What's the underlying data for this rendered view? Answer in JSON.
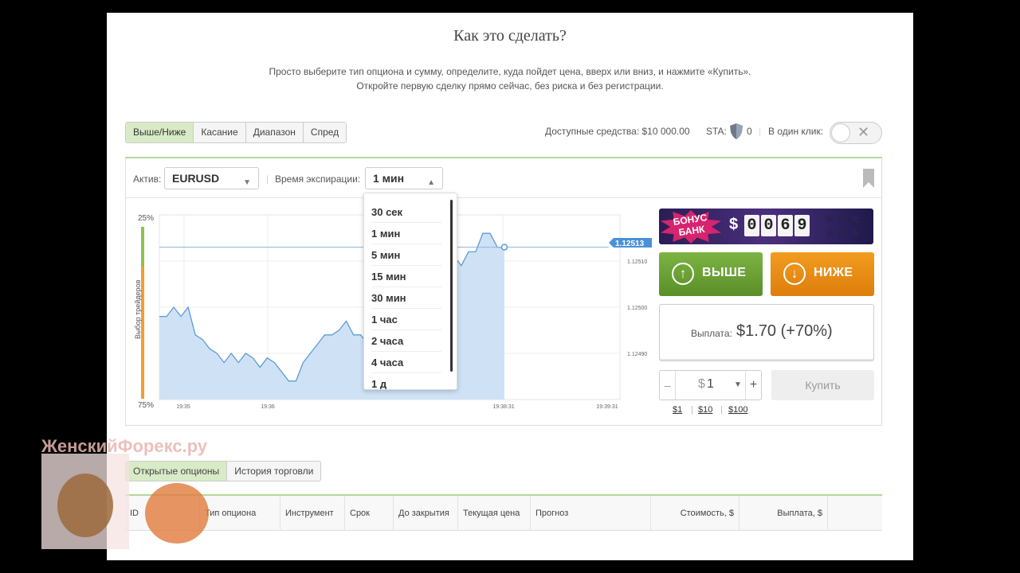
{
  "heading": "Как это сделать?",
  "intro_line1": "Просто выберите тип опциона и сумму, определите, куда пойдет цена, вверх или вниз, и нажмите «Купить».",
  "intro_line2": "Откройте первую сделку прямо сейчас, без риска и без регистрации.",
  "option_tabs": [
    "Выше/Ниже",
    "Касание",
    "Диапазон",
    "Спред"
  ],
  "active_tab": "Выше/Ниже",
  "balance_label": "Доступные средства: $10 000.00",
  "sta_label": "STA:",
  "sta_value": "0",
  "one_click_label": "В один клик:",
  "asset_label": "Актив:",
  "asset_value": "EURUSD",
  "expiry_label": "Время экспирации:",
  "expiry_value": "1 мин",
  "expiry_options": [
    "30 сек",
    "1 мин",
    "5 мин",
    "15 мин",
    "30 мин",
    "1 час",
    "2 часа",
    "4 часа",
    "1 д"
  ],
  "chart": {
    "traders_label": "Выбор трейдеров",
    "pct_top": "25%",
    "pct_bottom": "75%",
    "current_price": "1.12513",
    "y_ticks": [
      "1.12510",
      "1.12500",
      "1.12490"
    ],
    "x_ticks": [
      "19:35",
      "19:36",
      "19:38:31",
      "19:39:31"
    ],
    "colors": {
      "line": "#5b9bd5",
      "fill": "#cfe2f5",
      "up_bar": "#8bc34a",
      "down_bar": "#f0a030"
    }
  },
  "chart_data": {
    "type": "area",
    "series": [
      {
        "values": [
          1.12498,
          1.12498,
          1.125,
          1.12498,
          1.125,
          1.12494,
          1.12493,
          1.12491,
          1.1249,
          1.12488,
          1.1249,
          1.12488,
          1.1249,
          1.12489,
          1.12487,
          1.12489,
          1.12488,
          1.12486,
          1.12484,
          1.12484,
          1.12488,
          1.1249,
          1.12492,
          1.12494,
          1.12494,
          1.12495,
          1.12497,
          1.12494,
          1.12494,
          1.12492,
          1.12492,
          1.12492,
          1.12492,
          1.12492,
          1.12492,
          1.12493,
          1.12493,
          1.12493,
          1.12493,
          1.12493,
          1.1251,
          1.12511,
          1.12509,
          1.12512,
          1.12512,
          1.12516,
          1.12516,
          1.12513,
          1.12513
        ]
      }
    ],
    "ylim": [
      1.1248,
      1.1252
    ]
  },
  "bonus": {
    "badge": "БОНУС БАНК",
    "currency": "$",
    "digits": [
      "0",
      "0",
      "6",
      "9"
    ]
  },
  "up_label": "ВЫШЕ",
  "down_label": "НИЖЕ",
  "payout_label": "Выплата:",
  "payout_value": "$1.70 (+70%)",
  "amount_currency": "$",
  "amount_value": "1",
  "buy_label": "Купить",
  "quick_amounts": [
    "$1",
    "$10",
    "$100"
  ],
  "bottom_tabs": [
    "Открытые опционы",
    "История торговли"
  ],
  "table_headers": [
    "ID",
    "Тип опциона",
    "Инструмент",
    "Срок",
    "До закрытия",
    "Текущая цена",
    "Прогноз",
    "Стоимость, $",
    "Выплата, $"
  ],
  "watermark": "ЖенскийФорекс.ру"
}
